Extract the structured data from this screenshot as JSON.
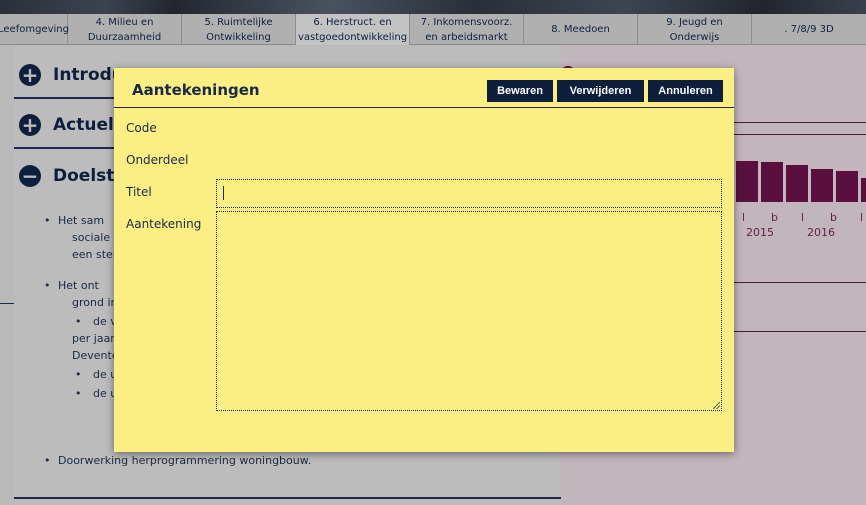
{
  "tabs": [
    {
      "label": "Leefomgeving"
    },
    {
      "label": "4. Milieu en Duurzaamheid"
    },
    {
      "label": "5. Ruimtelijke Ontwikkeling"
    },
    {
      "label": "6. Herstruct. en vastgoedontwikkeling"
    },
    {
      "label": "7. Inkomensvoorz. en arbeidsmarkt"
    },
    {
      "label": "8. Meedoen"
    },
    {
      "label": "9. Jeugd en Onderwijs"
    },
    {
      "label": ". 7/8/9 3D"
    }
  ],
  "sections": [
    {
      "icon": "+",
      "title": "Introduc"
    },
    {
      "icon": "+",
      "title": "Actuele"
    },
    {
      "icon": "−",
      "title": "Doelste"
    }
  ],
  "content": {
    "b1_l1": "Het sam",
    "b1_l2": "sociale",
    "b1_l3": "een ster",
    "b2_l1": "Het ont",
    "b2_l2": "grond in",
    "b2_sub1": "de v",
    "b2_l3": "per jaar",
    "b2_l4": "Devente",
    "b2_sub2": "de u",
    "b2_sub3": "de u",
    "b3": "Doorwerking herprogrammering woningbouw."
  },
  "chart": {
    "tick_labels": [
      "l",
      "b",
      "l",
      "b",
      "l"
    ],
    "years": [
      "2015",
      "2016"
    ]
  },
  "chart_data": {
    "type": "bar",
    "categories": [
      "l",
      "b",
      "l",
      "b",
      "l",
      "b",
      "l"
    ],
    "values": [
      75,
      73,
      68,
      60,
      57,
      44,
      0
    ],
    "xlabel": "",
    "ylabel": "",
    "years": [
      "2015",
      "2016"
    ]
  },
  "modal": {
    "title": "Aantekeningen",
    "save_label": "Bewaren",
    "delete_label": "Verwijderen",
    "cancel_label": "Annuleren",
    "code_label": "Code",
    "section_label": "Onderdeel",
    "title_label": "Titel",
    "note_label": "Aantekening",
    "title_value": "",
    "note_value": ""
  },
  "colors": {
    "navy": "#0e1f3d",
    "note_yellow": "#fbef84",
    "chart_purple": "#5b0f3e"
  }
}
